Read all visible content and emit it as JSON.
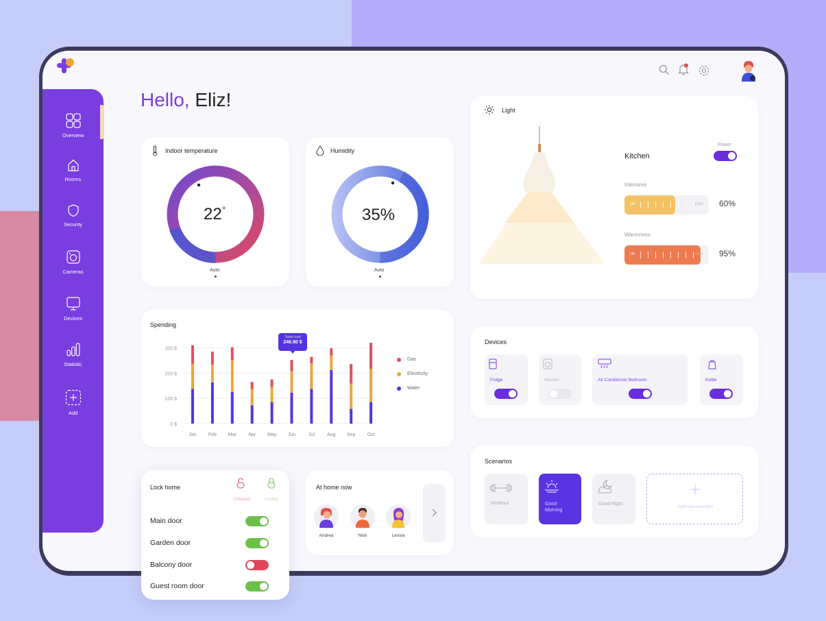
{
  "greeting": {
    "hello": "Hello,",
    "name": "Eliz!"
  },
  "sidebar": {
    "items": [
      {
        "label": "Overview"
      },
      {
        "label": "Rooms"
      },
      {
        "label": "Security"
      },
      {
        "label": "Cameras"
      },
      {
        "label": "Devices"
      },
      {
        "label": "Statistic"
      },
      {
        "label": "Add"
      }
    ]
  },
  "temperature": {
    "title": "Indoor temperature",
    "value": "22",
    "unit": "°",
    "mode": "Auto"
  },
  "humidity": {
    "title": "Humidity",
    "value": "35%",
    "mode": "Auto"
  },
  "light": {
    "title": "Light",
    "room": "Kitchen",
    "power_label": "Power",
    "intensive_label": "Intensive",
    "intensive_value": "60%",
    "intensive_fraction": 0.6,
    "warmness_label": "Warmness",
    "warmness_value": "95%",
    "warmness_fraction": 0.95,
    "off_label": "Off",
    "max_label": "100%",
    "intensive_color": "#f2c265",
    "warmness_color": "#ee7b4f"
  },
  "spending": {
    "title": "Spending",
    "tooltip_title": "Total cost",
    "tooltip_value": "246.80 $",
    "legend": [
      "Gas",
      "Electricity",
      "Water"
    ]
  },
  "chart_data": {
    "type": "bar",
    "stacked": true,
    "categories": [
      "Jan",
      "Feb",
      "Mar",
      "Apr",
      "May",
      "Jun",
      "Jul",
      "Aug",
      "Sep",
      "Oct"
    ],
    "series": [
      {
        "name": "Water",
        "color": "#5534e0",
        "values": [
          137,
          163,
          125,
          72,
          85,
          122,
          137,
          212,
          58,
          85
        ]
      },
      {
        "name": "Electricity",
        "color": "#eaa63f",
        "values": [
          100,
          70,
          125,
          65,
          60,
          85,
          102,
          58,
          100,
          132
        ]
      },
      {
        "name": "Gas",
        "color": "#e0505f",
        "values": [
          73,
          52,
          52,
          28,
          30,
          45,
          25,
          28,
          78,
          103
        ]
      }
    ],
    "yticks": [
      "300 $",
      "200 $",
      "100 $",
      "0 $"
    ],
    "ylim": [
      0,
      320
    ],
    "legend_position": "right"
  },
  "devices": {
    "title": "Devices",
    "items": [
      {
        "label": "Fridge",
        "on": true
      },
      {
        "label": "Washer",
        "on": false
      },
      {
        "label": "Air Conditioner Bedroom",
        "on": true
      },
      {
        "label": "Kettle",
        "on": true
      }
    ]
  },
  "scenarios": {
    "title": "Scenarios",
    "items": [
      {
        "label": "Workout"
      },
      {
        "label": "Good Morning"
      },
      {
        "label": "Good Night"
      }
    ],
    "add_label": "Add new scenario"
  },
  "lock": {
    "title": "Lock home",
    "unlocked_label": "Unlocked",
    "locked_label": "Locked",
    "doors": [
      {
        "label": "Main door",
        "state": "locked"
      },
      {
        "label": "Garden door",
        "state": "locked"
      },
      {
        "label": "Balcony door",
        "state": "unlocked"
      },
      {
        "label": "Guest room door",
        "state": "locked"
      }
    ]
  },
  "at_home": {
    "title": "At home now",
    "people": [
      {
        "name": "Andrea"
      },
      {
        "name": "Nick"
      },
      {
        "name": "Lessia"
      }
    ]
  },
  "colors": {
    "brand": "#7a3de0",
    "accent_orange": "#f2a531",
    "toggle_on": "#6a2ddc",
    "green": "#6cc04a",
    "red": "#e0465a"
  },
  "icons": [
    "logo-icon",
    "search-icon",
    "bell-icon",
    "gear-icon",
    "avatar"
  ]
}
